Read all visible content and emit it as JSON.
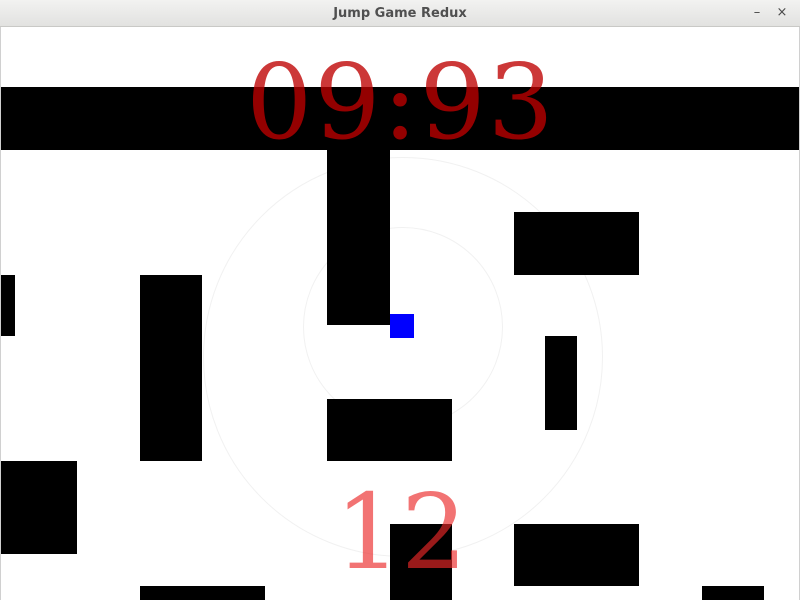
{
  "window": {
    "title": "Jump Game Redux",
    "minimize_glyph": "–",
    "close_glyph": "×"
  },
  "hud": {
    "timer": "09:93",
    "score": "12"
  },
  "colors": {
    "player": "#0000ff",
    "walls": "#000000",
    "timer": "#be0000",
    "score": "#eb2828",
    "background": "#ffffff"
  }
}
